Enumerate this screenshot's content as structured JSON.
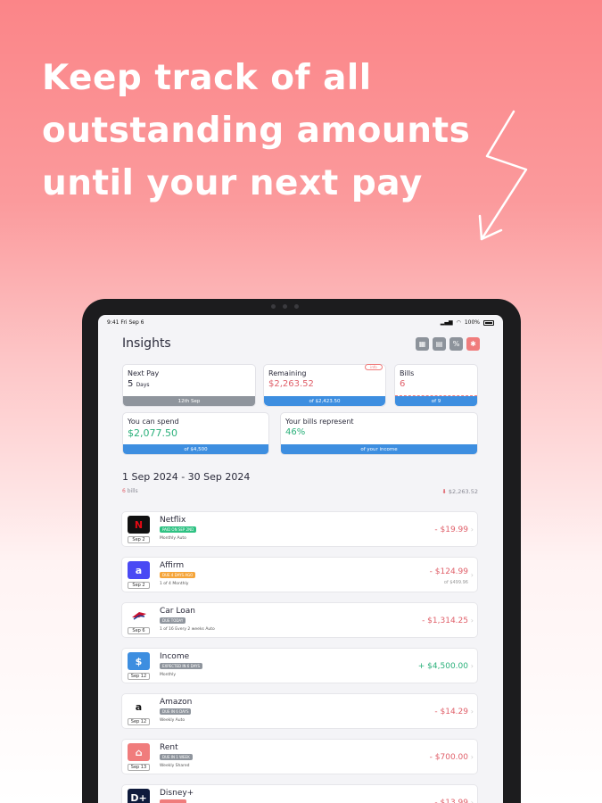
{
  "headline": [
    "Keep track of all",
    "outstanding amounts",
    "until your next pay"
  ],
  "status_bar": {
    "time": "9:41",
    "date": "Fri Sep 6",
    "battery": "100%"
  },
  "insights": {
    "title": "Insights",
    "toolbar_icons": [
      "calendar-icon",
      "chart-icon",
      "percent-icon",
      "gear-icon"
    ],
    "cards": {
      "next_pay": {
        "label": "Next Pay",
        "value_num": "5",
        "value_unit": "Days",
        "footer": "12th Sep"
      },
      "remaining": {
        "label": "Remaining",
        "value": "$2,263.52",
        "footer": "of $2,423.50",
        "pill": "info"
      },
      "bills": {
        "label": "Bills",
        "value": "6",
        "footer": "of 9"
      },
      "can_spend": {
        "label": "You can spend",
        "value": "$2,077.50",
        "footer": "of $4,500"
      },
      "bills_represent": {
        "label": "Your bills represent",
        "value": "46%",
        "footer": "of your income"
      }
    },
    "period": "1 Sep 2024 - 30 Sep 2024",
    "bill_count_num": "6",
    "bill_count_word": "bills",
    "total": "$2,263.52"
  },
  "bills": [
    {
      "name": "Netflix",
      "date": "Sep 2",
      "tag": "PAID ON SEP 2ND",
      "tag_color": "#2fc283",
      "meta": "Monthly  Auto",
      "amount": "- $19.99",
      "sub": "",
      "logo_text": "N",
      "logo_bg": "#111111",
      "logo_color": "#e50914",
      "icon": "netflix-logo"
    },
    {
      "name": "Affirm",
      "date": "Sep 2",
      "tag": "DUE 4 DAYS AGO",
      "tag_color": "#f5a53a",
      "meta": "1 of 4  Monthly",
      "amount": "- $124.99",
      "sub": "of $499.96",
      "logo_text": "a",
      "logo_bg": "#4a4af4",
      "logo_color": "#ffffff",
      "icon": "affirm-logo"
    },
    {
      "name": "Car Loan",
      "date": "Sep 6",
      "tag": "DUE TODAY",
      "tag_color": "#8f959d",
      "meta": "1 of 16  Every 2 weeks  Auto",
      "amount": "- $1,314.25",
      "sub": "",
      "logo_text": "",
      "logo_bg": "#ffffff",
      "logo_color": "#c8102e",
      "icon": "bank-flag-logo"
    },
    {
      "name": "Income",
      "date": "Sep 12",
      "tag": "EXPECTED IN 6 DAYS",
      "tag_color": "#8f959d",
      "meta": "Monthly",
      "amount": "+ $4,500.00",
      "sub": "",
      "logo_text": "$",
      "logo_bg": "#3d8ee0",
      "logo_color": "#ffffff",
      "icon": "money-bag-icon"
    },
    {
      "name": "Amazon",
      "date": "Sep 12",
      "tag": "DUE IN 6 DAYS",
      "tag_color": "#8f959d",
      "meta": "Weekly  Auto",
      "amount": "- $14.29",
      "sub": "",
      "logo_text": "a",
      "logo_bg": "#ffffff",
      "logo_color": "#111111",
      "icon": "amazon-logo"
    },
    {
      "name": "Rent",
      "date": "Sep 13",
      "tag": "DUE IN 1 WEEK",
      "tag_color": "#8f959d",
      "meta": "Weekly  Shared",
      "amount": "- $700.00",
      "sub": "",
      "logo_text": "⌂",
      "logo_bg": "#f07c7c",
      "logo_color": "#ffffff",
      "icon": "house-icon"
    },
    {
      "name": "Disney+",
      "date": "",
      "tag": "",
      "tag_color": "#f07c7c",
      "meta": "",
      "amount": "- $13.99",
      "sub": "",
      "logo_text": "D+",
      "logo_bg": "#0f1b3c",
      "logo_color": "#ffffff",
      "icon": "disney-logo"
    }
  ],
  "colors": {
    "accent": "#f07c7c",
    "blue": "#3d8ee0",
    "gray": "#8f959d",
    "negative": "#e0606a",
    "positive": "#2ab07a"
  }
}
